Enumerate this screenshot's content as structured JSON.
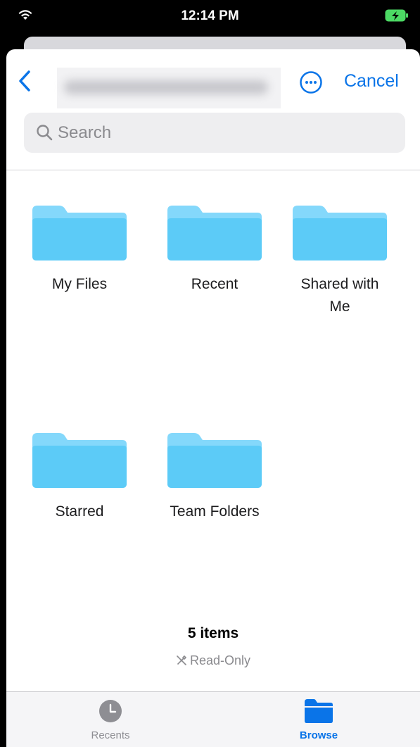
{
  "status_bar": {
    "time": "12:14 PM"
  },
  "nav": {
    "cancel_label": "Cancel"
  },
  "search": {
    "placeholder": "Search"
  },
  "items": [
    {
      "label": "My Files"
    },
    {
      "label": "Recent"
    },
    {
      "label": "Shared with Me"
    },
    {
      "label": "Starred"
    },
    {
      "label": "Team Folders"
    }
  ],
  "footer": {
    "count": "5 items",
    "read_only": "Read-Only"
  },
  "tabs": [
    {
      "label": "Recents",
      "icon": "clock-icon",
      "active": false
    },
    {
      "label": "Browse",
      "icon": "folder-icon",
      "active": true
    }
  ],
  "colors": {
    "accent": "#0a74e8",
    "folder_light": "#84d8fb",
    "folder": "#5ccbf7",
    "tab_inactive": "#8e8e93"
  }
}
